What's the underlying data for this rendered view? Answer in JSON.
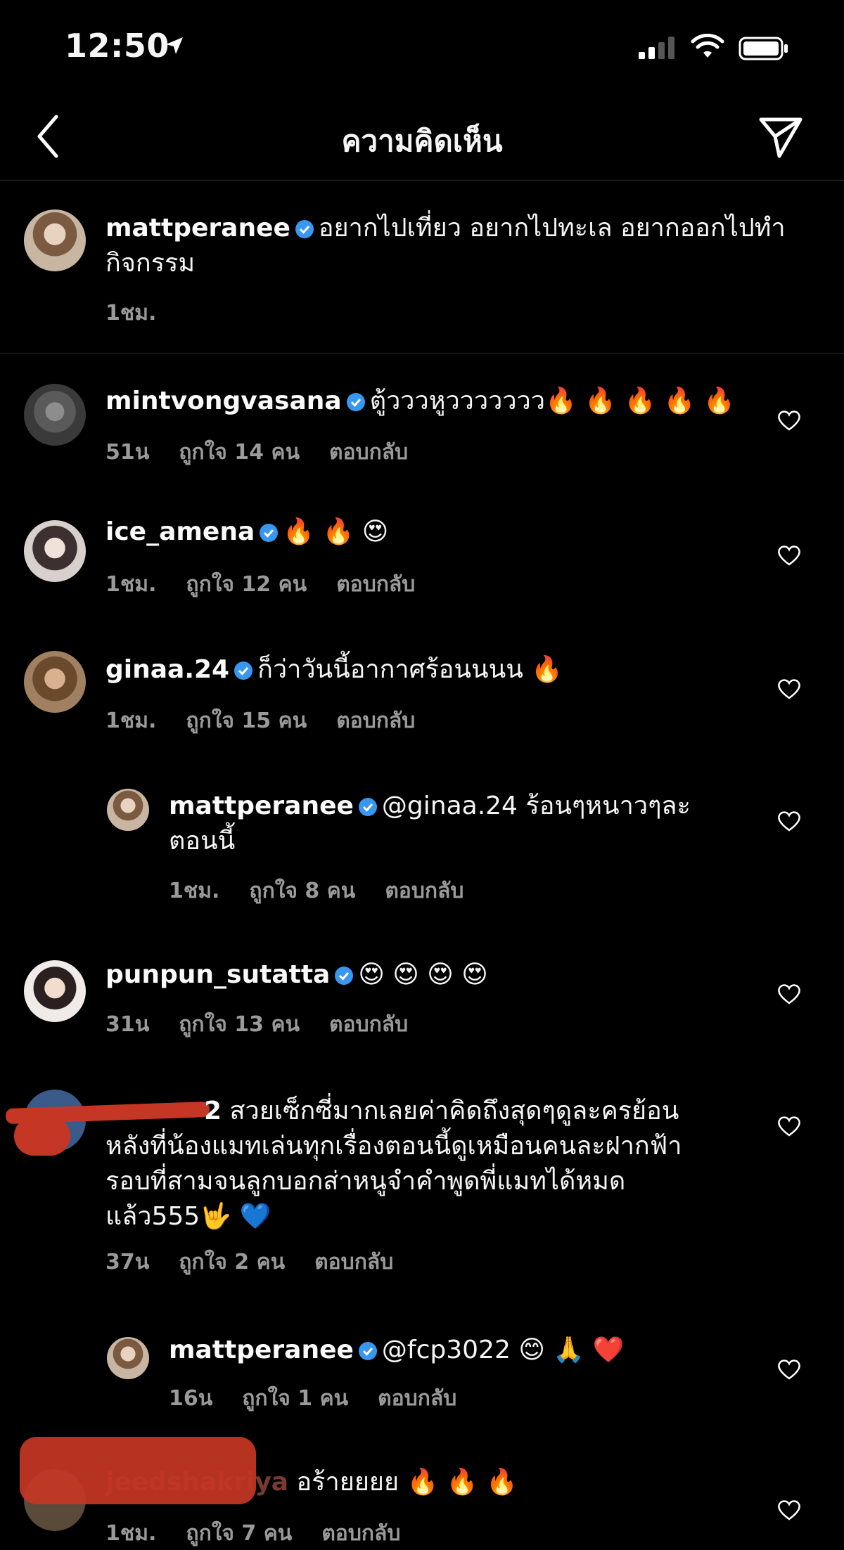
{
  "status_bar": {
    "time": "12:50"
  },
  "header": {
    "title": "ความคิดเห็น"
  },
  "caption": {
    "username": "mattperanee",
    "text_line1": "อยากไปเที่ยว อยากไปทะเล อยากออกไปทำ",
    "text_line2": "กิจกรรม",
    "time": "1ชม."
  },
  "comments": [
    {
      "username": "mintvongvasana",
      "text": "ตู้วววหูววววววว",
      "emoji": "🔥 🔥 🔥 🔥 🔥",
      "time": "51น",
      "likes": "ถูกใจ 14 คน",
      "reply": "ตอบกลับ"
    },
    {
      "username": "ice_amena",
      "text": "",
      "emoji": "🔥 🔥 😍",
      "time": "1ชม.",
      "likes": "ถูกใจ 12 คน",
      "reply": "ตอบกลับ"
    },
    {
      "username": "ginaa.24",
      "text": "ก็ว่าวันนี้อากาศร้อนนนน",
      "emoji": "🔥",
      "time": "1ชม.",
      "likes": "ถูกใจ 15 คน",
      "reply": "ตอบกลับ"
    },
    {
      "username": "mattperanee",
      "text": "@ginaa.24 ร้อนๆหนาวๆละ",
      "text2": "ตอนนี้",
      "time": "1ชม.",
      "likes": "ถูกใจ 8 คน",
      "reply": "ตอบกลับ"
    },
    {
      "username": "punpun_sutatta",
      "text": "",
      "emoji": "😍 😍 😍 😍",
      "time": "31น",
      "likes": "ถูกใจ 13 คน",
      "reply": "ตอบกลับ"
    },
    {
      "username_tail": "2",
      "line1": "สวยเซ็กซี่มากเลยค่าคิดถึงสุดๆดูละครย้อน",
      "line2": "หลังที่น้องแมทเล่นทุกเรื่องตอนนี้ดูเหมือนคนละฝากฟ้า",
      "line3": "รอบที่สามจนลูกบอกส่าหนูจำคำพูดพี่แมทได้หมด",
      "line4": "แล้ว555",
      "emoji": "🤟 💙",
      "time": "37น",
      "likes": "ถูกใจ 2 คน",
      "reply": "ตอบกลับ"
    },
    {
      "username": "mattperanee",
      "text": "@fcp3022",
      "emoji": "😊 🙏 ❤️",
      "time": "16น",
      "likes": "ถูกใจ 1 คน",
      "reply": "ตอบกลับ"
    },
    {
      "username": "jeedshakriya",
      "text": "อร้ายยยย",
      "emoji": "🔥 🔥 🔥",
      "time": "1ชม.",
      "likes": "ถูกใจ 7 คน",
      "reply": "ตอบกลับ"
    }
  ],
  "colors": {
    "background": "#000000",
    "verified": "#3897f0",
    "meta": "#9a9a9a",
    "redaction": "#c63624"
  }
}
